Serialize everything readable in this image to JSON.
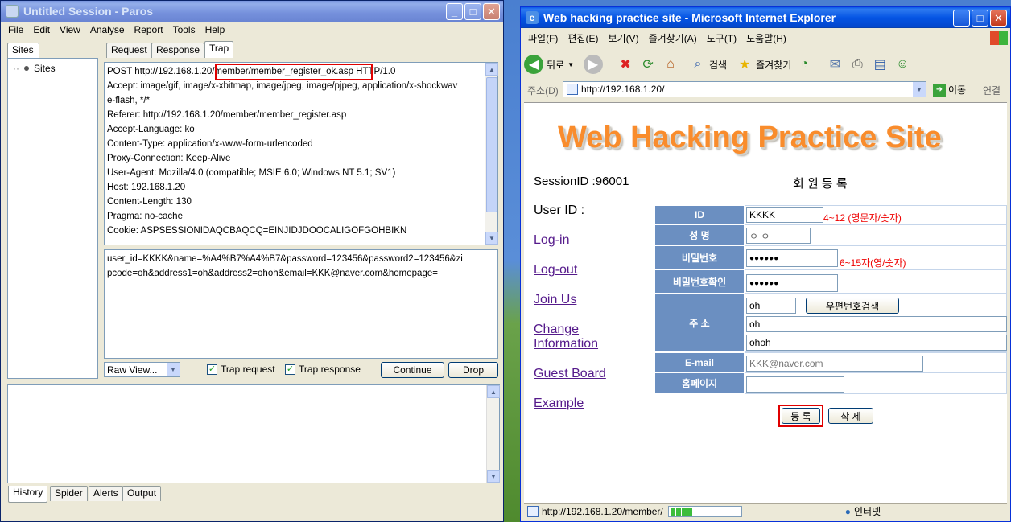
{
  "paros": {
    "title": "Untitled Session - Paros",
    "menu": [
      "File",
      "Edit",
      "View",
      "Analyse",
      "Report",
      "Tools",
      "Help"
    ],
    "sites_tab": "Sites",
    "sites_root": "Sites",
    "tabs": [
      "Request",
      "Response",
      "Trap"
    ],
    "header_lines": [
      "POST http://192.168.1.20/member/member_register_ok.asp HTTP/1.0",
      "Accept: image/gif, image/x-xbitmap, image/jpeg, image/pjpeg, application/x-shockwav",
      "e-flash, */*",
      "Referer: http://192.168.1.20/member/member_register.asp",
      "Accept-Language: ko",
      "Content-Type: application/x-www-form-urlencoded",
      "Proxy-Connection: Keep-Alive",
      "User-Agent: Mozilla/4.0 (compatible; MSIE 6.0; Windows NT 5.1; SV1)",
      "Host: 192.168.1.20",
      "Content-Length: 130",
      "Pragma: no-cache",
      "Cookie: ASPSESSIONIDAQCBAQCQ=EINJIDJDOOCALIGOFGOHBIKN"
    ],
    "body_lines": [
      "user_id=KKKK&name=%A4%B7%A4%B7&password=123456&password2=123456&zi",
      "pcode=oh&address1=oh&address2=ohoh&email=KKK@naver.com&homepage="
    ],
    "view_select": "Raw View...",
    "trap_request": "Trap request",
    "trap_response": "Trap response",
    "continue_btn": "Continue",
    "drop_btn": "Drop",
    "bottom_tabs": [
      "History",
      "Spider",
      "Alerts",
      "Output"
    ]
  },
  "ie": {
    "title": "Web hacking practice site - Microsoft Internet Explorer",
    "menu": [
      "파일(F)",
      "편집(E)",
      "보기(V)",
      "즐겨찾기(A)",
      "도구(T)",
      "도움말(H)"
    ],
    "back": "뒤로",
    "search": "검색",
    "favorites": "즐겨찾기",
    "address_label": "주소(D)",
    "address": "http://192.168.1.20/",
    "go": "이동",
    "links": "연결",
    "banner": "Web Hacking Practice Site",
    "session": "SessionID :96001",
    "form_title": "회 원 등 록",
    "userid_label": "User ID :",
    "nav": [
      "Log-in",
      "Log-out",
      "Join Us",
      "Change",
      "Information",
      "Guest Board",
      "Example"
    ],
    "fields": {
      "id_label": "ID",
      "id_value": "KKKK",
      "id_hint": "4~12 (영문자/숫자)",
      "name_label": "성 명",
      "name_value": "ㅇ ㅇ",
      "pw_label": "비밀번호",
      "pw_value": "●●●●●●",
      "pw_hint": "6~15자(영/숫자)",
      "pw2_label": "비밀번호확인",
      "pw2_value": "●●●●●●",
      "addr_label": "주 소",
      "zip_value": "oh",
      "zip_btn": "우편번호검색",
      "addr1_value": "oh",
      "addr2_value": "ohoh",
      "email_label": "E-mail",
      "email_value": "KKK@naver.com",
      "home_label": "홈페이지",
      "home_value": ""
    },
    "register_btn": "등 록",
    "delete_btn": "삭 제",
    "status_url": "http://192.168.1.20/member/",
    "zone": "인터넷"
  }
}
